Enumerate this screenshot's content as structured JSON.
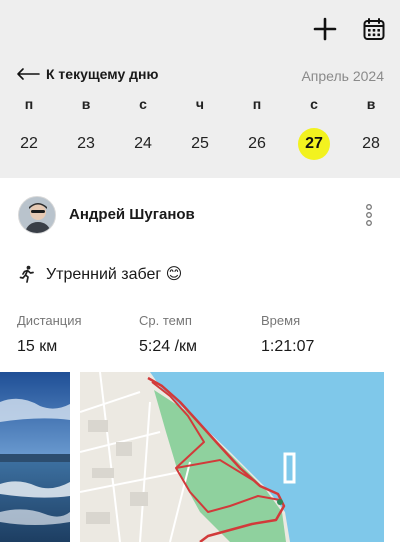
{
  "toolbar": {
    "add_icon": "plus-icon",
    "calendar_icon": "calendar-icon"
  },
  "nav": {
    "back_label": "К текущему дню",
    "month_label": "Апрель 2024"
  },
  "week": {
    "days": [
      {
        "letter": "п",
        "num": "22"
      },
      {
        "letter": "в",
        "num": "23"
      },
      {
        "letter": "с",
        "num": "24"
      },
      {
        "letter": "ч",
        "num": "25"
      },
      {
        "letter": "п",
        "num": "26"
      },
      {
        "letter": "с",
        "num": "27",
        "selected": true
      },
      {
        "letter": "в",
        "num": "28"
      }
    ],
    "selected_color": "#f2f21f"
  },
  "activity": {
    "user_name": "Андрей Шуганов",
    "title": "Утренний забег 😊",
    "stats": [
      {
        "label": "Дистанция",
        "value": "15 км"
      },
      {
        "label": "Ср. темп",
        "value": "5:24 /км"
      },
      {
        "label": "Время",
        "value": "1:21:07"
      }
    ]
  },
  "colors": {
    "header_bg": "#eeeeee",
    "route": "#d23a3a",
    "water": "#7fc8ea"
  }
}
